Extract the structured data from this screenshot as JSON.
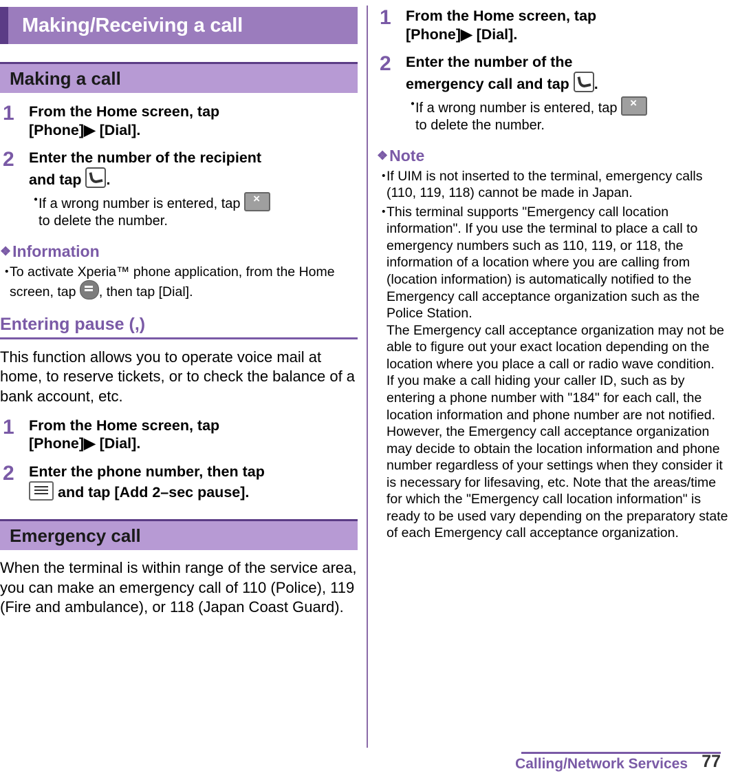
{
  "chapter": {
    "title": "Making/Receiving a call"
  },
  "left": {
    "section1": {
      "heading": "Making a call",
      "steps": [
        {
          "num": "1",
          "line1": "From the Home screen, tap",
          "line2_a": "[Phone]",
          "line2_arrow": "▶",
          "line2_b": "[Dial]."
        },
        {
          "num": "2",
          "line1": "Enter the number of the recipient",
          "line2": "and tap",
          "line2_end": ".",
          "sub_bullet": "・",
          "sub_line1": "If a wrong number is entered, tap",
          "sub_line2": "to delete the number."
        }
      ],
      "information": {
        "title": "Information",
        "flower": "❖",
        "items": [
          {
            "bullet": "・",
            "text_a": "To activate Xperia™ phone application, from the Home screen, tap",
            "text_b": ", then tap [Dial]."
          }
        ]
      }
    },
    "section2": {
      "subheading": "Entering pause (,)",
      "paragraph": "This function allows you to operate voice mail at home, to reserve tickets, or to check the balance of a bank account, etc.",
      "steps": [
        {
          "num": "1",
          "line1": "From the Home screen, tap",
          "line2_a": "[Phone]",
          "line2_arrow": "▶",
          "line2_b": "[Dial]."
        },
        {
          "num": "2",
          "line1": "Enter the phone number, then tap",
          "line2": "and tap [Add 2–sec pause]."
        }
      ]
    },
    "section3": {
      "heading": "Emergency call",
      "paragraph": "When the terminal is within range of the service area, you can make an emergency call of 110 (Police), 119 (Fire and ambulance), or 118 (Japan Coast Guard)."
    }
  },
  "right": {
    "steps": [
      {
        "num": "1",
        "line1": "From the Home screen, tap",
        "line2_a": "[Phone]",
        "line2_arrow": "▶",
        "line2_b": "[Dial]."
      },
      {
        "num": "2",
        "line1": "Enter the number of the",
        "line2": "emergency call and tap",
        "line2_end": ".",
        "sub_bullet": "・",
        "sub_line1": "If a wrong number is entered, tap",
        "sub_line2": "to delete the number."
      }
    ],
    "note": {
      "title": "Note",
      "flower": "❖",
      "items": [
        {
          "bullet": "・",
          "text": "If UIM is not inserted to the terminal, emergency calls (110, 119, 118) cannot be made in Japan."
        },
        {
          "bullet": "・",
          "text": "This terminal supports \"Emergency call location information\". If you use the terminal to place a call to emergency numbers such as 110, 119, or 118, the information of a location where you are calling from (location information) is automatically notified to the Emergency call acceptance organization such as the Police Station."
        }
      ],
      "paragraphs": [
        "The Emergency call acceptance organization may not be able to figure out your exact location depending on the location where you place a call or radio wave condition.",
        "If you make a call hiding your caller ID, such as by entering a phone number with \"184\" for each call, the location information and phone number are not notified. However, the Emergency call acceptance organization may decide to obtain the location information and phone number regardless of your settings when they consider it is necessary for lifesaving, etc. Note that the areas/time for which the \"Emergency call location information\" is ready to be used vary depending on the preparatory state of each Emergency call acceptance organization."
      ]
    }
  },
  "footer": {
    "section_name": "Calling/Network Services",
    "page_number": "77"
  },
  "colors": {
    "accent": "#7a5aa6",
    "band": "#b79ad4",
    "title_bar": "#9b7cbd",
    "title_bar_edge": "#5b3c86"
  },
  "icons": {
    "phone": "phone-icon",
    "delete": "delete-backspace-icon",
    "menu": "menu-icon",
    "app": "app-launcher-icon"
  }
}
